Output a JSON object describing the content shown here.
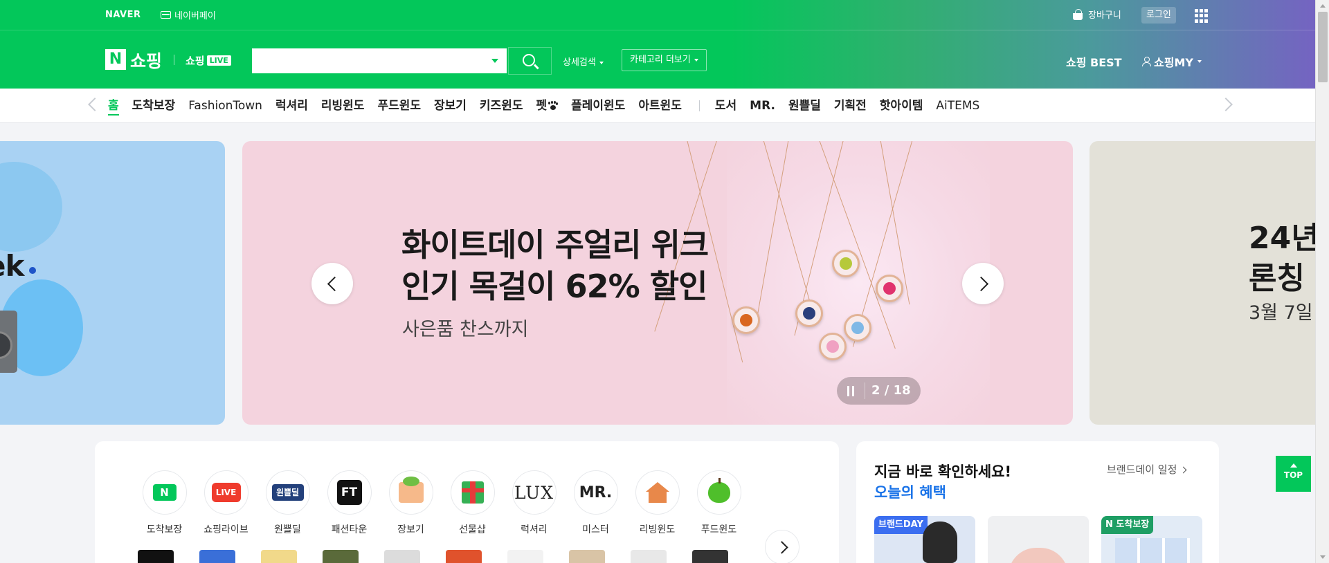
{
  "header": {
    "naver_logo": "NAVER",
    "naverpay": "네이버페이",
    "cart": "장바구니",
    "login": "로그인",
    "shopping_title": "쇼핑",
    "n_letter": "N",
    "live_prefix": "쇼핑",
    "live_badge": "LIVE",
    "search": {
      "placeholder": "",
      "value": ""
    },
    "detail_search": "상세검색",
    "category_more": "카테고리 더보기",
    "best": "쇼핑 BEST",
    "my": "쇼핑MY"
  },
  "nav": {
    "items": [
      "홈",
      "도착보장",
      "FashionTown",
      "럭셔리",
      "리빙윈도",
      "푸드윈도",
      "장보기",
      "키즈윈도",
      "펫",
      "플레이윈도",
      "아트윈도"
    ],
    "items2": [
      "도서",
      "MR.",
      "원쁠딜",
      "기획전",
      "핫아이템",
      "AiTEMS"
    ]
  },
  "banner": {
    "left_text": "ek",
    "title_line1": "화이트데이 주얼리 위크",
    "title_line2": "인기 목걸이 62% 할인",
    "subtitle": "사은품 찬스까지",
    "counter": "2 / 18",
    "right_title_line1": "24년",
    "right_title_line2": "론칭",
    "right_sub": "3월 7일"
  },
  "categories": [
    {
      "label": "도착보장",
      "icon": "arrival-guarantee-icon",
      "glyph": "N"
    },
    {
      "label": "쇼핑라이브",
      "icon": "shopping-live-icon",
      "glyph": "LIVE"
    },
    {
      "label": "원쁠딜",
      "icon": "one-plus-deal-icon",
      "glyph": "원쁠딜"
    },
    {
      "label": "패션타운",
      "icon": "fashion-town-icon",
      "glyph": "FT"
    },
    {
      "label": "장보기",
      "icon": "grocery-basket-icon",
      "glyph": ""
    },
    {
      "label": "선물샵",
      "icon": "gift-box-icon",
      "glyph": ""
    },
    {
      "label": "럭셔리",
      "icon": "luxury-icon",
      "glyph": "LUX"
    },
    {
      "label": "미스터",
      "icon": "mister-icon",
      "glyph": "MR."
    },
    {
      "label": "리빙윈도",
      "icon": "house-icon",
      "glyph": ""
    },
    {
      "label": "푸드윈도",
      "icon": "apple-icon",
      "glyph": ""
    }
  ],
  "benefits": {
    "title": "지금 바로 확인하세요!",
    "subtitle": "오늘의 혜택",
    "schedule_link": "브랜드데이 일정",
    "promo1_tag": "브랜드DAY",
    "promo3_tag": "N 도착보장"
  },
  "top_button": "TOP",
  "colors": {
    "brand_green": "#03c75a",
    "banner_pink": "#f4d3de",
    "link_blue": "#1a73e8"
  }
}
